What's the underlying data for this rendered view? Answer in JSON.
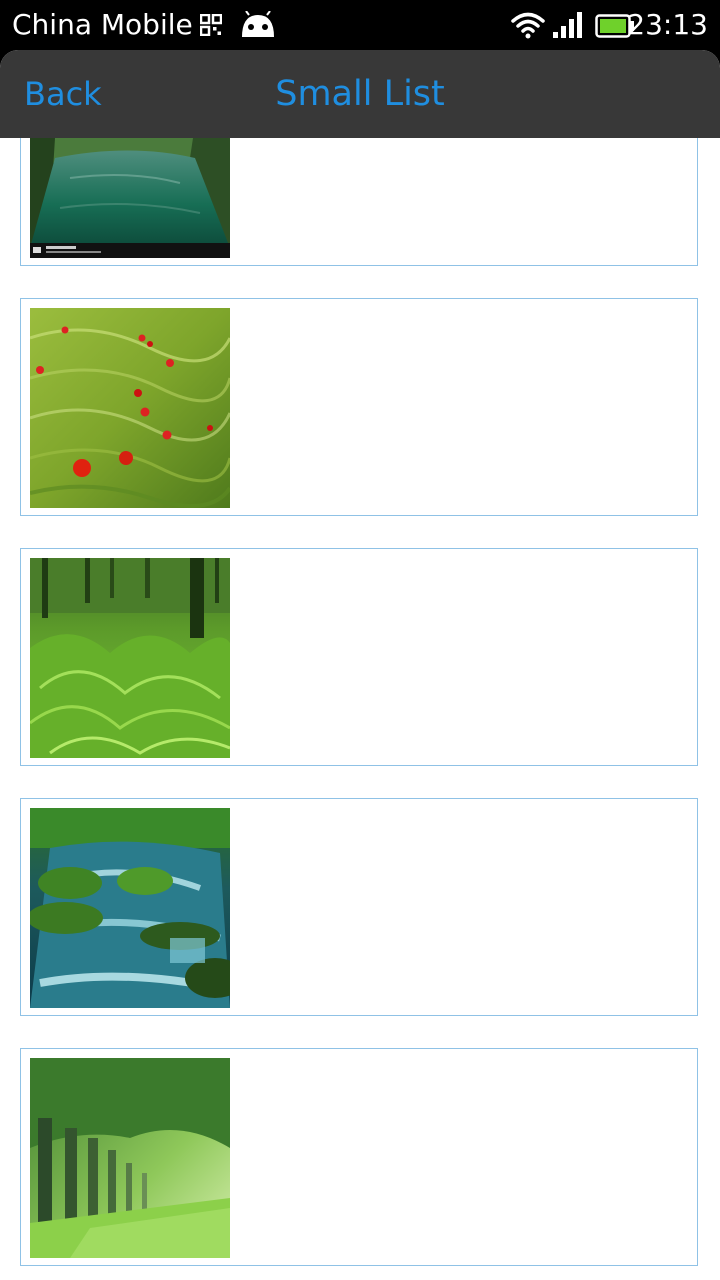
{
  "status_bar": {
    "carrier": "China Mobile",
    "time": "23:13",
    "icons": [
      "qr-icon",
      "android-icon",
      "wifi-icon",
      "signal-icon",
      "battery-icon"
    ]
  },
  "header": {
    "back_label": "Back",
    "title": "Small List"
  },
  "list": {
    "items": [
      {
        "image": "river-canal-photo"
      },
      {
        "image": "poppy-field-photo"
      },
      {
        "image": "fern-forest-photo"
      },
      {
        "image": "mossy-stream-photo"
      },
      {
        "image": "tree-avenue-photo"
      }
    ]
  },
  "colors": {
    "accent": "#1f8ee0",
    "title_bar": "#383838",
    "item_border": "#8fc2e6"
  }
}
